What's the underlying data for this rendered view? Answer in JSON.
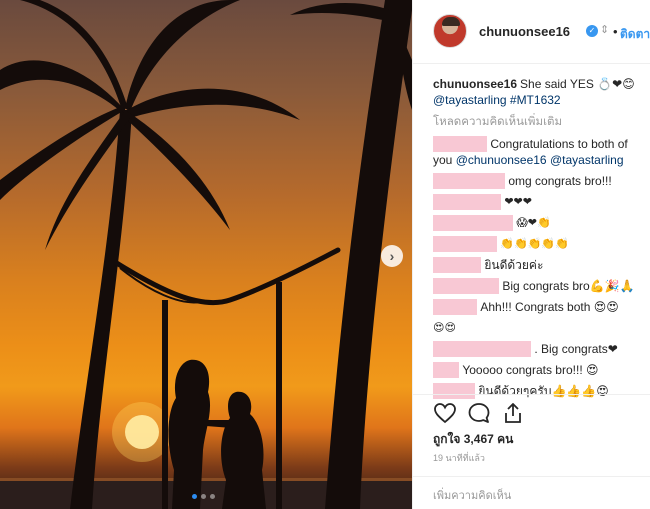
{
  "post": {
    "username": "chunuonsee16",
    "verified_glyph": "✓",
    "flag": "⇕",
    "separator": "•",
    "follow_label": "ติดตาม",
    "next_glyph": "›"
  },
  "caption": {
    "username": "chunuonsee16",
    "text": "She said YES 💍❤😊",
    "mention": "@tayastarling",
    "hashtag": "#MT1632"
  },
  "load_more": "โหลดความคิดเห็นเพิ่มเติม",
  "comments": [
    {
      "text_before": "Congratulations to both of you ",
      "mention1": "@chunuonsee16",
      "mention2": "@tayastarling"
    },
    {
      "text": "omg congrats bro!!!"
    },
    {
      "text": "❤❤❤"
    },
    {
      "text": "😱❤👏"
    },
    {
      "text": "👏👏👏👏👏"
    },
    {
      "text": "ยินดีด้วยค่ะ"
    },
    {
      "text": "Big congrats bro💪🎉🙏"
    },
    {
      "text": "Ahh!!! Congrats both 😍😍"
    },
    {
      "text": "😍😍"
    },
    {
      "text": ". Big congrats❤"
    },
    {
      "text": "Yooooo congrats bro!!! 😍"
    },
    {
      "text": "ยินดีด้วยๆครับ👍👍👍😍"
    }
  ],
  "likes": "ถูกใจ 3,467 คน",
  "time_ago": "19 นาทีที่แล้ว",
  "add_comment_placeholder": "เพิ่มความคิดเห็น",
  "colors": {
    "accent": "#3897f0",
    "mention": "#003569",
    "redacted": "#f8c8d4"
  },
  "icons": [
    "heart-icon",
    "comment-icon",
    "share-icon"
  ]
}
